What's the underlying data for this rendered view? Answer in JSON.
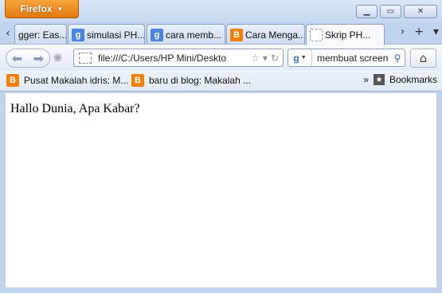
{
  "titlebar": {
    "firefox_label": "Firefox",
    "window_buttons": {
      "minimize": "▭",
      "maximize": "▭",
      "close": "✕"
    }
  },
  "tabs": [
    {
      "label": "gger: Eas...",
      "icon": "blogger-icon"
    },
    {
      "label": "simulasi PH...",
      "icon": "google-icon"
    },
    {
      "label": "cara memb...",
      "icon": "google-icon"
    },
    {
      "label": "Cara Menga...",
      "icon": "blogger-icon"
    },
    {
      "label": "Skrip PH...",
      "icon": "blank-page-icon",
      "active": true
    }
  ],
  "tab_controls": {
    "scroll_left": "‹",
    "scroll_right": "›",
    "new_tab": "+",
    "list_all": "▾"
  },
  "navbar": {
    "url": "file:///C:/Users/HP Mini/Deskto",
    "search_value": "membuat screen",
    "search_engine": "Google"
  },
  "bookmarks": {
    "items": [
      {
        "label": "Pusat Makalah idris: M...",
        "icon": "blogger-icon"
      },
      {
        "label": "baru di blog: Makalah ...",
        "icon": "blogger-icon"
      }
    ],
    "overflow": "»",
    "menu_label": "Bookmarks"
  },
  "page": {
    "text": "Hallo Dunia, Apa Kabar?"
  },
  "colors": {
    "firefox_button": "#e2780e",
    "chrome_bg": "#bfd3ee",
    "blogger": "#f57d00",
    "google": "#4a84e0"
  }
}
